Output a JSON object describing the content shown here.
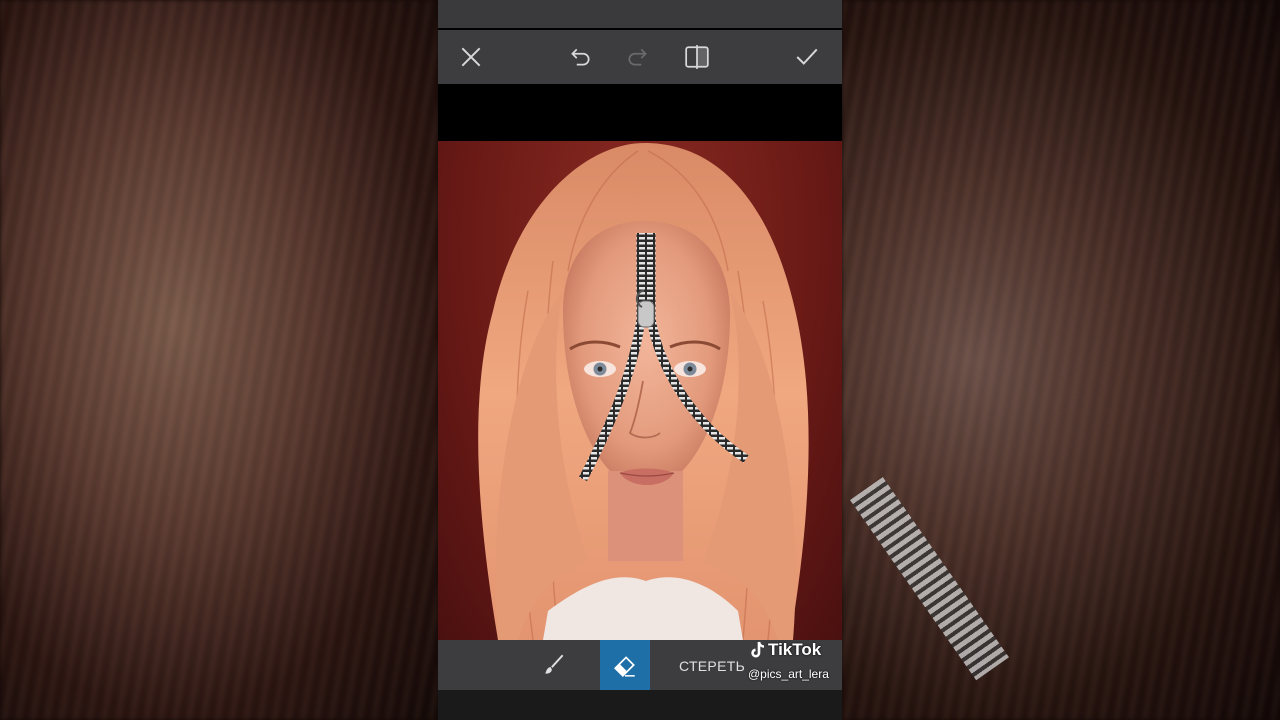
{
  "toolbar": {
    "close_icon": "close-icon",
    "undo_icon": "undo-icon",
    "redo_icon": "redo-icon",
    "compare_icon": "compare-icon",
    "apply_icon": "check-icon"
  },
  "bottom_bar": {
    "brush_icon": "brush-icon",
    "eraser_icon": "eraser-icon",
    "mode_label": "СТЕРЕТЬ",
    "active_tool": "eraser"
  },
  "watermark": {
    "brand": "TikTok",
    "handle": "@pics_art_lera"
  },
  "colors": {
    "toolbar_bg": "#3d3d3f",
    "active_tool_bg": "#1e6fa8",
    "canvas_bg": "#6a1a16"
  }
}
